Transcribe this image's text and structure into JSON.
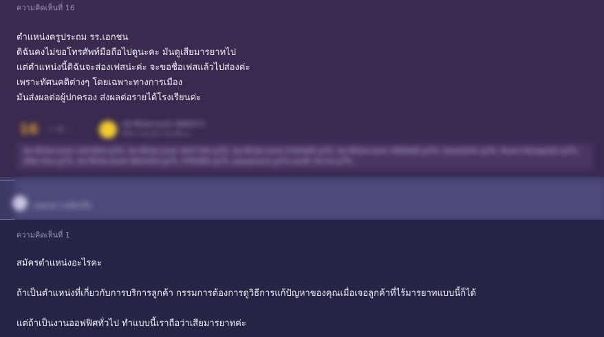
{
  "comment16": {
    "header": "ความคิดเห็นที่ 16",
    "lines": [
      "ตำแหน่งครูประถม รร.เอกชน",
      "ดิฉันคงไม่ขอโทรศัพท์มือถือไปดูนะคะ มันดูเสียมารยาทไป",
      "แต่ตำแหน่งนี้ดิฉันจะส่องเฟสน่ะค่ะ  จะขอชื่อเฟสแล้วไปส่องค่ะ",
      "เพราะทัศนคติต่างๆ โดยเฉพาะทางการเมือง",
      "มันส่งผลต่อผู้ปกครอง ส่งผลต่อรายได้โรงเรียนค่ะ"
    ],
    "number": "16",
    "meta_icons": "☆  ✉ ···",
    "author": "สมาชิกหมายเลข 3889573",
    "date": "Mon 10 Jan 22:00 น.",
    "reactions": "สมาชิกหมายเลข 1367899 ถูกใจ, สมาชิกหมายเลข 3657789 ถูกใจ, สมาชิกหมายเลข 5765488 ถูกใจ, สมาชิกหมายเลข 7898489 ถูกใจ, Sweetiefix ถูกใจ, Peach Marigoldie ถูกใจ, Mike Kiss ถูกใจ, สมาชิกหมายเลข 4805499 ถูกใจ, PITAZBA ถูกใจ, Jujujukuma ถูกใจ และอีก 26 คน ถูกใจ"
  },
  "reply": {
    "placeholder": "แสดงความคิดเห็น"
  },
  "comment1": {
    "header": "ความคิดเห็นที่ 1",
    "lines": [
      "สมัครตำแหน่งอะไรคะ",
      "ถ้าเป็นตำแหน่งที่เกี่ยวกับการบริการลูกค้า กรรมการต้องการดูวิธีการแก้ปัญหาของคุณเมื่อเจอลูกค้าที่ไร้มารยาทแบบนี้ก็ได้",
      "แต่ถ้าเป็นงานออฟฟิศทั่วไป ทำแบบนี้เราถือว่าเสียมารยาทค่ะ"
    ]
  },
  "colors": {
    "top_bg": "#3a2a4f",
    "bottom_bg": "#262545",
    "reply_bg": "#4c4a7a",
    "accent_orange": "#d89a2c"
  }
}
